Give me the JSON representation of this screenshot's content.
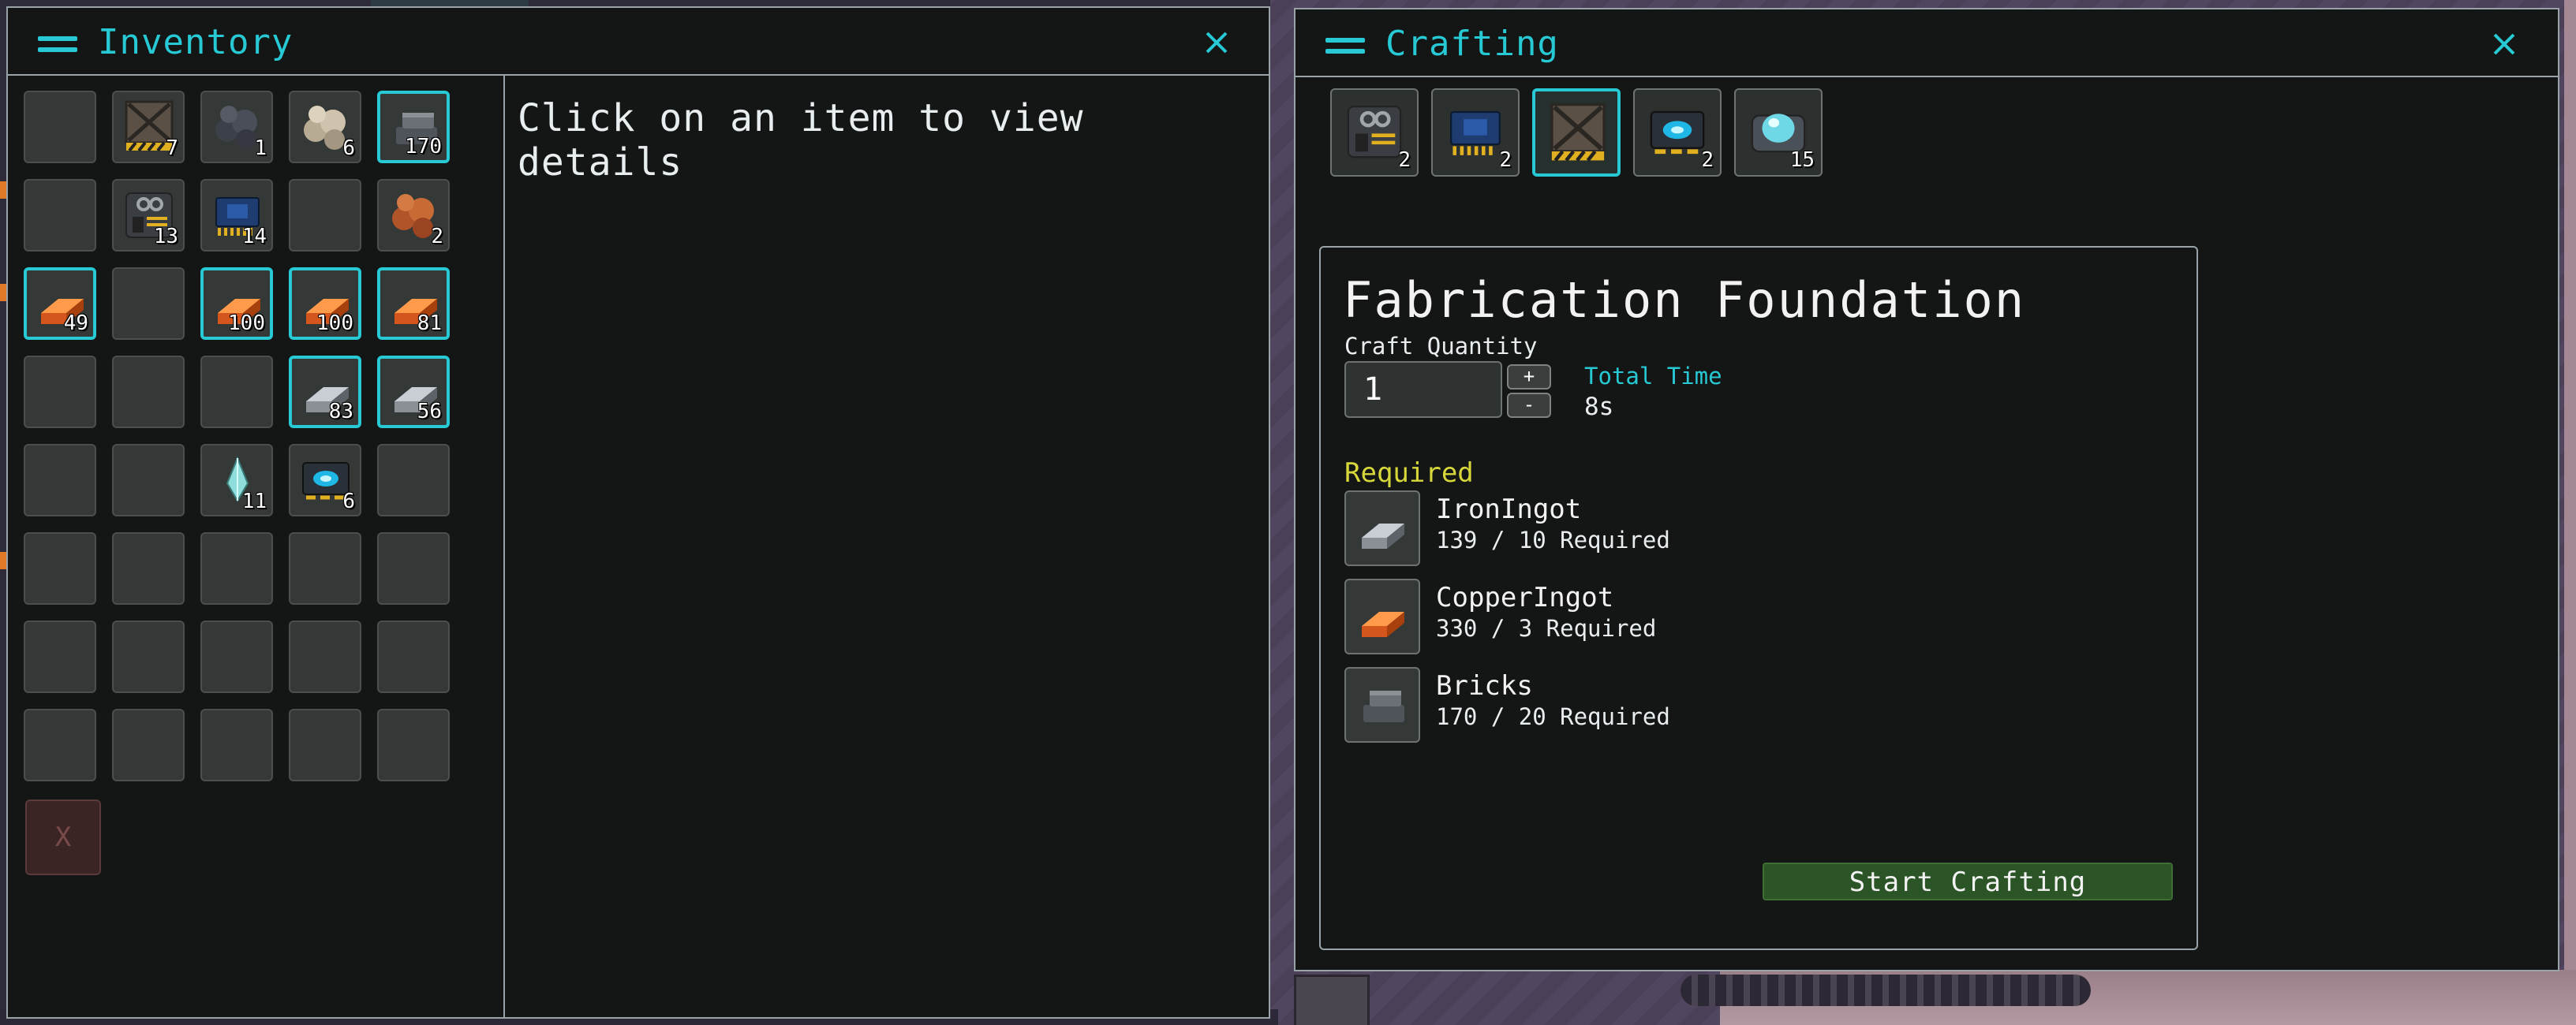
{
  "colors": {
    "accent": "#27c9d4",
    "required": "#d7d63a",
    "craft_button": "#2b5526"
  },
  "inventory": {
    "title": "Inventory",
    "details_prompt": "Click on an item to view details",
    "trash_label": "X",
    "slots": [
      {
        "icon": "",
        "count": ""
      },
      {
        "icon": "fabrication-foundation-icon",
        "count": "7"
      },
      {
        "icon": "coal-ore-icon",
        "count": "1"
      },
      {
        "icon": "stone-ore-icon",
        "count": "6"
      },
      {
        "icon": "bricks-icon",
        "count": "170",
        "highlighted": true
      },
      {
        "icon": "",
        "count": ""
      },
      {
        "icon": "machine-parts-icon",
        "count": "13"
      },
      {
        "icon": "circuit-board-icon",
        "count": "14"
      },
      {
        "icon": "",
        "count": ""
      },
      {
        "icon": "copper-ore-icon",
        "count": "2"
      },
      {
        "icon": "copper-ingot-icon",
        "count": "49",
        "highlighted": true
      },
      {
        "icon": "",
        "count": ""
      },
      {
        "icon": "copper-ingot-icon",
        "count": "100",
        "highlighted": true
      },
      {
        "icon": "copper-ingot-icon",
        "count": "100",
        "highlighted": true
      },
      {
        "icon": "copper-ingot-icon",
        "count": "81",
        "highlighted": true
      },
      {
        "icon": "",
        "count": ""
      },
      {
        "icon": "",
        "count": ""
      },
      {
        "icon": "",
        "count": ""
      },
      {
        "icon": "iron-ingot-icon",
        "count": "83",
        "highlighted": true
      },
      {
        "icon": "iron-ingot-icon",
        "count": "56",
        "highlighted": true
      },
      {
        "icon": "",
        "count": ""
      },
      {
        "icon": "",
        "count": ""
      },
      {
        "icon": "crystal-shard-icon",
        "count": "11"
      },
      {
        "icon": "teleporter-pad-icon",
        "count": "6"
      },
      {
        "icon": "",
        "count": ""
      },
      {
        "icon": "",
        "count": ""
      },
      {
        "icon": "",
        "count": ""
      },
      {
        "icon": "",
        "count": ""
      },
      {
        "icon": "",
        "count": ""
      },
      {
        "icon": "",
        "count": ""
      },
      {
        "icon": "",
        "count": ""
      },
      {
        "icon": "",
        "count": ""
      },
      {
        "icon": "",
        "count": ""
      },
      {
        "icon": "",
        "count": ""
      },
      {
        "icon": "",
        "count": ""
      },
      {
        "icon": "",
        "count": ""
      },
      {
        "icon": "",
        "count": ""
      },
      {
        "icon": "",
        "count": ""
      },
      {
        "icon": "",
        "count": ""
      },
      {
        "icon": "",
        "count": ""
      }
    ]
  },
  "crafting": {
    "title": "Crafting",
    "recipes": [
      {
        "icon": "machine-parts-icon",
        "count": "2"
      },
      {
        "icon": "circuit-board-icon",
        "count": "2"
      },
      {
        "icon": "fabrication-foundation-icon",
        "count": "",
        "selected": true
      },
      {
        "icon": "teleporter-pad-icon",
        "count": "2"
      },
      {
        "icon": "energy-pod-icon",
        "count": "15"
      }
    ],
    "selected": {
      "name": "Fabrication Foundation",
      "quantity_label": "Craft Quantity",
      "quantity": "1",
      "plus_label": "+",
      "minus_label": "-",
      "total_time_label": "Total Time",
      "total_time": "8s",
      "required_label": "Required",
      "requirements": [
        {
          "icon": "iron-ingot-icon",
          "name": "IronIngot",
          "amount": "139 / 10 Required"
        },
        {
          "icon": "copper-ingot-icon",
          "name": "CopperIngot",
          "amount": "330 / 3 Required"
        },
        {
          "icon": "bricks-icon",
          "name": "Bricks",
          "amount": "170 / 20 Required"
        }
      ],
      "start_label": "Start Crafting"
    }
  }
}
